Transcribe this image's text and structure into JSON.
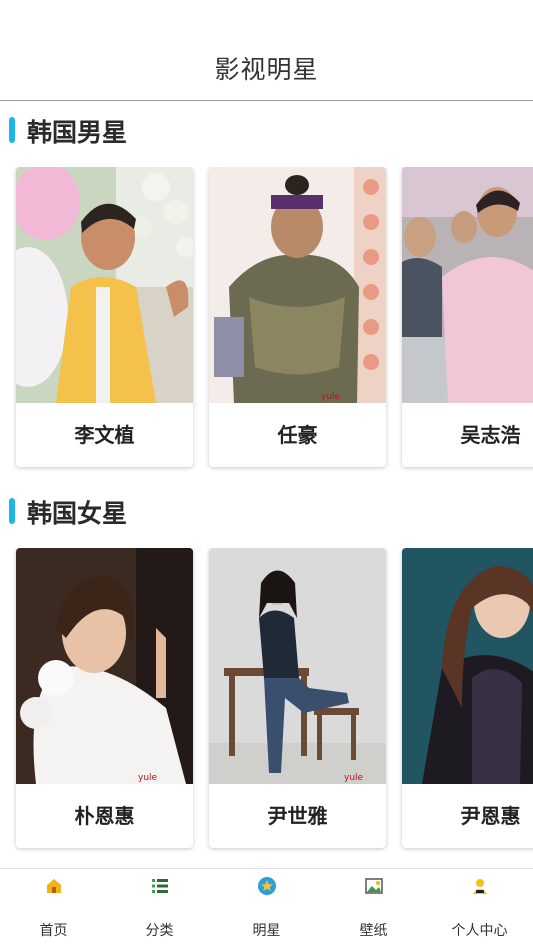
{
  "header": {
    "title": "影视明星"
  },
  "sections": [
    {
      "title": "韩国男星",
      "cards": [
        {
          "name": "李文植"
        },
        {
          "name": "任豪"
        },
        {
          "name": "吴志浩"
        }
      ]
    },
    {
      "title": "韩国女星",
      "cards": [
        {
          "name": "朴恩惠"
        },
        {
          "name": "尹世雅"
        },
        {
          "name": "尹恩惠"
        }
      ]
    }
  ],
  "tabbar": {
    "items": [
      {
        "label": "首页",
        "icon": "home-icon"
      },
      {
        "label": "分类",
        "icon": "list-icon"
      },
      {
        "label": "明星",
        "icon": "star-icon"
      },
      {
        "label": "壁纸",
        "icon": "picture-icon"
      },
      {
        "label": "个人中心",
        "icon": "user-icon"
      }
    ]
  }
}
